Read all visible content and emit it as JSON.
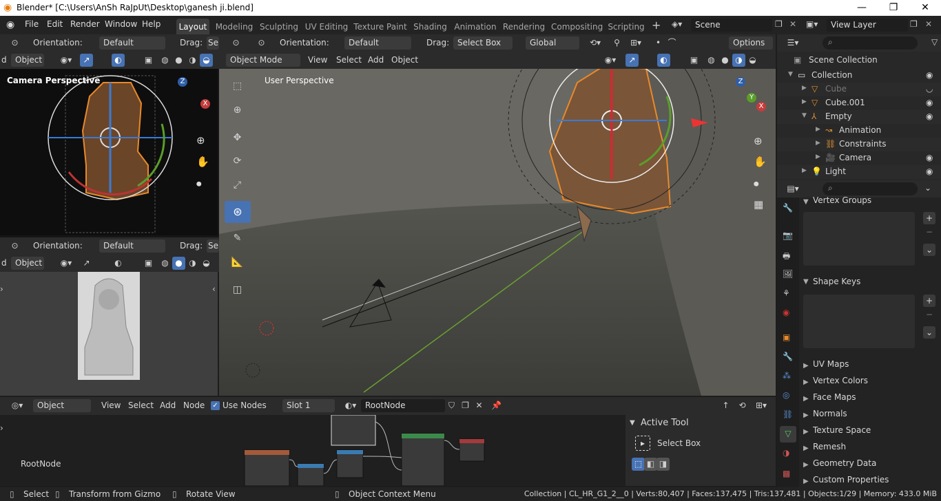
{
  "window": {
    "title": "Blender* [C:\\Users\\AnSh RaJpUt\\Desktop\\ganesh ji.blend]",
    "minimize": "—",
    "maximize": "❐",
    "close": "✕"
  },
  "menu": [
    "File",
    "Edit",
    "Render",
    "Window",
    "Help"
  ],
  "workspaces": [
    "Layout",
    "Modeling",
    "Sculpting",
    "UV Editing",
    "Texture Paint",
    "Shading",
    "Animation",
    "Rendering",
    "Compositing",
    "Scripting"
  ],
  "scene": {
    "label": "Scene",
    "view_layer": "View Layer"
  },
  "left_top": {
    "orientation_label": "Orientation:",
    "orientation": "Default",
    "drag_label": "Drag:",
    "drag_value": "Se",
    "mode_frag": "d",
    "object": "Object",
    "overlay_text": "Camera Perspective"
  },
  "left_bottom": {
    "orientation_label": "Orientation:",
    "orientation": "Default",
    "drag_label": "Drag:",
    "drag_value": "Se",
    "mode_frag": "d",
    "object": "Object"
  },
  "main_view": {
    "orientation_label": "Orientation:",
    "orientation": "Default",
    "drag_label": "Drag:",
    "drag_value": "Select Box",
    "transform": "Global",
    "options": "Options",
    "mode": "Object Mode",
    "menus": [
      "View",
      "Select",
      "Add",
      "Object"
    ],
    "overlay_text": "User Perspective"
  },
  "node_editor": {
    "editor": "Object",
    "menus": [
      "View",
      "Select",
      "Add",
      "Node"
    ],
    "use_nodes": "Use Nodes",
    "slot": "Slot 1",
    "material": "RootNode",
    "node_label": "RootNode"
  },
  "active_tool": {
    "header": "Active Tool",
    "tool": "Select Box"
  },
  "outliner": {
    "root": "Scene Collection",
    "items": [
      {
        "name": "Collection",
        "depth": 1
      },
      {
        "name": "Cube",
        "depth": 2,
        "dim": true
      },
      {
        "name": "Cube.001",
        "depth": 2
      },
      {
        "name": "Empty",
        "depth": 2
      },
      {
        "name": "Animation",
        "depth": 3
      },
      {
        "name": "Constraints",
        "depth": 3
      },
      {
        "name": "Camera",
        "depth": 3
      },
      {
        "name": "Light",
        "depth": 2
      }
    ]
  },
  "properties": {
    "sections": [
      "Vertex Groups",
      "Shape Keys",
      "UV Maps",
      "Vertex Colors",
      "Face Maps",
      "Normals",
      "Texture Space",
      "Remesh",
      "Geometry Data",
      "Custom Properties"
    ]
  },
  "statusbar": {
    "select": "Select",
    "transform": "Transform from Gizmo",
    "rotate": "Rotate View",
    "context": "Object Context Menu",
    "stats": "Collection | CL_HR_G1_2__0 | Verts:80,407 | Faces:137,475 | Tris:137,481 | Objects:1/29 | Memory: 433.0 MiB"
  },
  "gizmo": {
    "x": "X",
    "y": "Y",
    "z": "Z"
  }
}
